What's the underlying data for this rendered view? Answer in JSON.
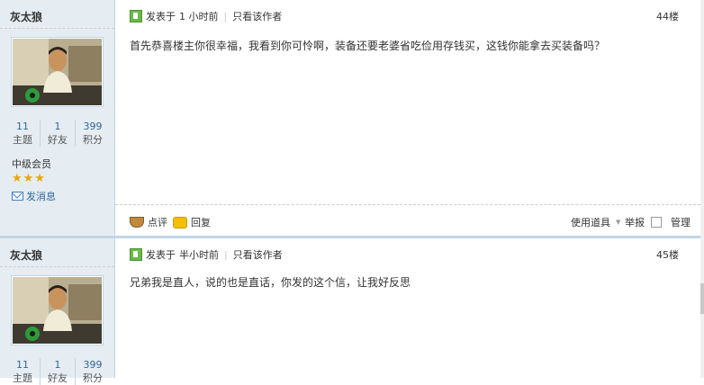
{
  "posts": [
    {
      "author": "灰太狼",
      "stats": [
        {
          "value": "11",
          "label": "主题"
        },
        {
          "value": "1",
          "label": "好友"
        },
        {
          "value": "399",
          "label": "积分"
        }
      ],
      "group": "中级会员",
      "stars": "★★★",
      "send_message": "发消息",
      "posted_prefix": "发表于",
      "posted_time": "1 小时前",
      "author_only": "只看该作者",
      "floor": "44楼",
      "message": "首先恭喜楼主你很幸福，我看到你可怜啊，装备还要老婆省吃俭用存钱买，这钱你能拿去买装备吗？",
      "actions": {
        "comment": "点评",
        "reply": "回复",
        "use_tool": "使用道具",
        "report": "举报",
        "manage": "管理"
      }
    },
    {
      "author": "灰太狼",
      "stats": [
        {
          "value": "11",
          "label": "主题"
        },
        {
          "value": "1",
          "label": "好友"
        },
        {
          "value": "399",
          "label": "积分"
        }
      ],
      "posted_prefix": "发表于",
      "posted_time": "半小时前",
      "author_only": "只看该作者",
      "floor": "45楼",
      "message": "兄弟我是直人，说的也是直话，你发的这个信，让我好反思"
    }
  ]
}
